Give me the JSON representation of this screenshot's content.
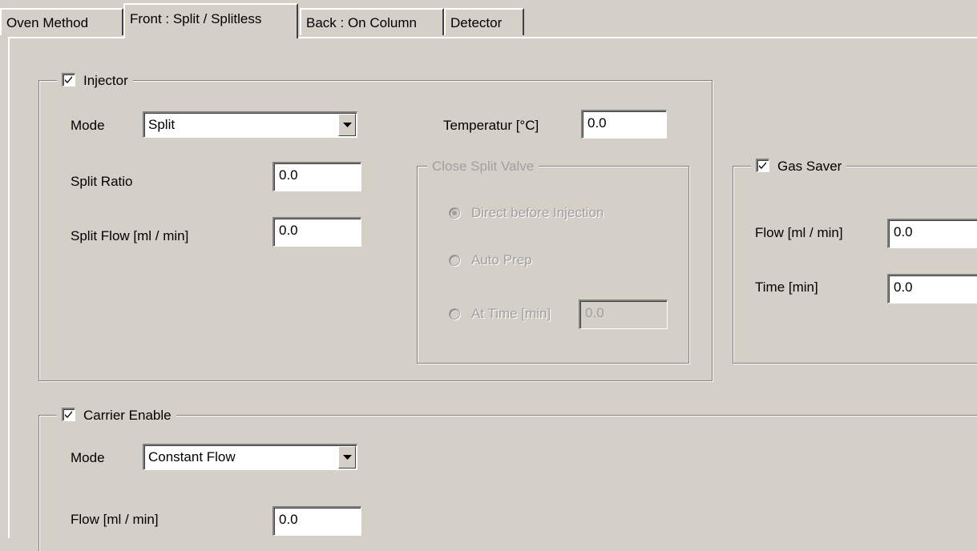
{
  "tabs": [
    {
      "label": "Oven Method"
    },
    {
      "label": "Front : Split / Splitless"
    },
    {
      "label": "Back : On Column"
    },
    {
      "label": "Detector"
    }
  ],
  "injector": {
    "title": "Injector",
    "checked": true,
    "mode_label": "Mode",
    "mode_value": "Split",
    "split_ratio_label": "Split Ratio",
    "split_ratio_value": "0.0",
    "split_flow_label": "Split Flow [ml / min]",
    "split_flow_value": "0.0",
    "temperature_label": "Temperatur [°C]",
    "temperature_value": "0.0"
  },
  "close_split_valve": {
    "title": "Close Split Valve",
    "options": [
      {
        "label": "Direct before Injection",
        "selected": true
      },
      {
        "label": "Auto Prep",
        "selected": false
      },
      {
        "label": "At Time [min]",
        "selected": false
      }
    ],
    "at_time_value": "0.0"
  },
  "gas_saver": {
    "title": "Gas Saver",
    "checked": true,
    "flow_label": "Flow [ml / min]",
    "flow_value": "0.0",
    "time_label": "Time [min]",
    "time_value": "0.0"
  },
  "carrier": {
    "title": "Carrier Enable",
    "checked": true,
    "mode_label": "Mode",
    "mode_value": "Constant Flow",
    "flow_label": "Flow [ml / min]",
    "flow_value": "0.0"
  },
  "colors": {
    "background": "#d4d0c8",
    "disabled_text": "#a0a0a0"
  }
}
